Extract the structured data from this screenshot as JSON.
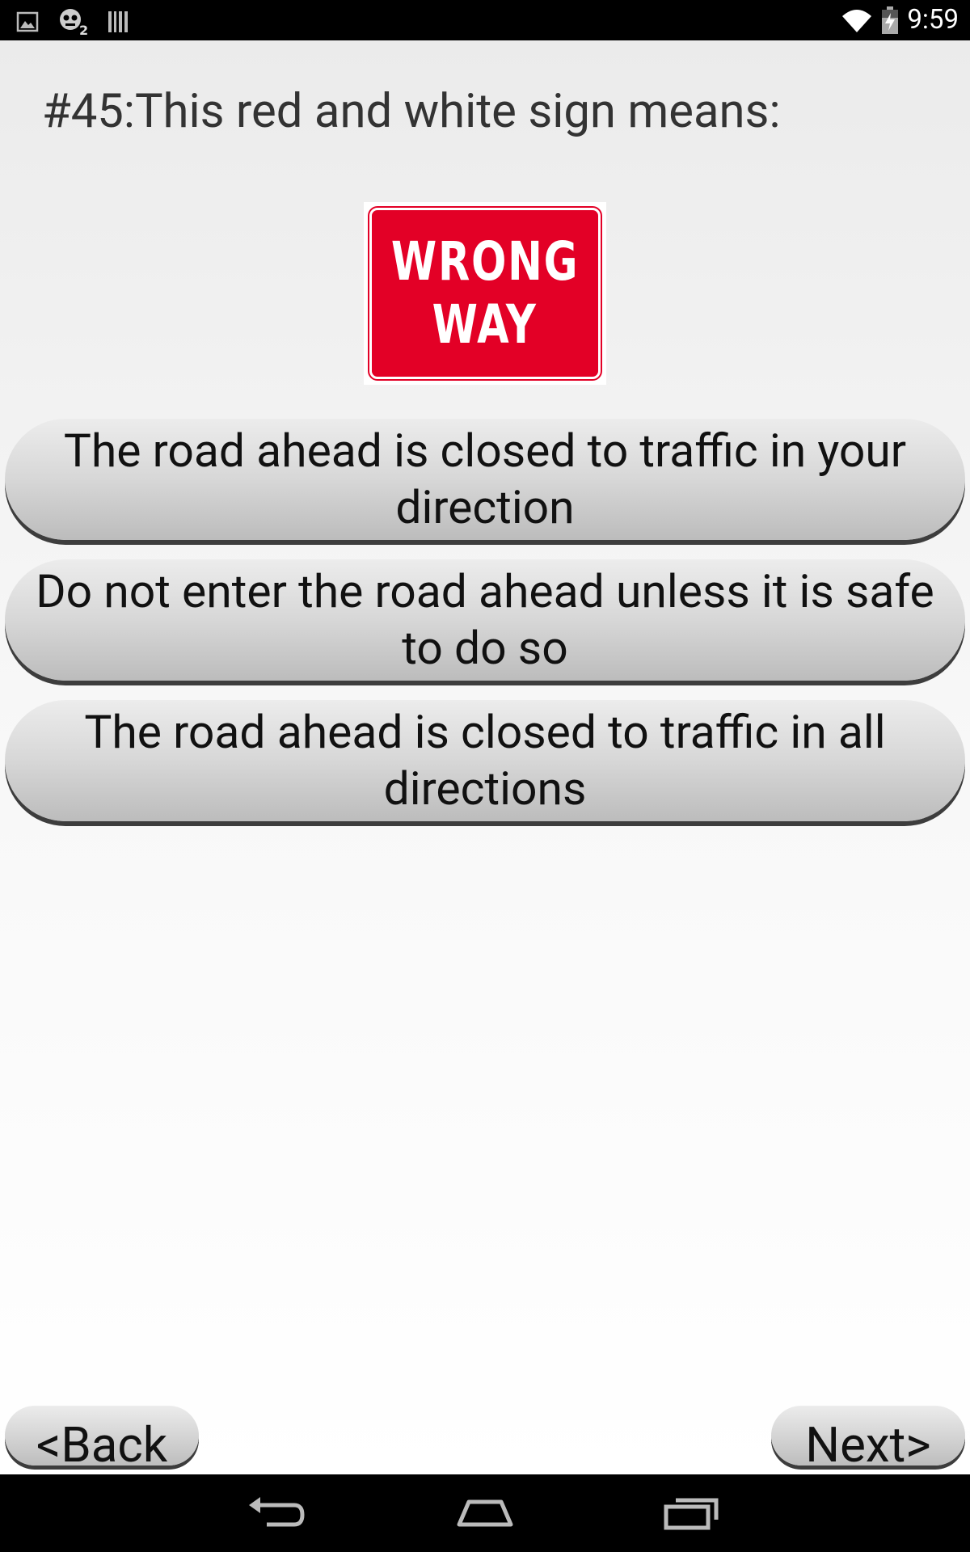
{
  "status_bar": {
    "time": "9:59",
    "left_icons": [
      "image-notification-icon",
      "game-app-icon",
      "barcode-icon"
    ],
    "right_icons": [
      "wifi-icon",
      "battery-charging-icon"
    ]
  },
  "quiz": {
    "question": "#45:This red and white sign means:",
    "sign": {
      "line1": "WRONG",
      "line2": "WAY",
      "colors": {
        "background": "#e30026",
        "text": "#ffffff"
      }
    },
    "answers": [
      {
        "label": "The road ahead is closed to traffic in your direction"
      },
      {
        "label": "Do not enter the road ahead unless it is safe to do so"
      },
      {
        "label": "The road ahead is closed to traffic in all directions"
      }
    ]
  },
  "navigation": {
    "back_label": "<Back",
    "next_label": "Next>"
  },
  "system_nav": {
    "buttons": [
      "back-arrow-icon",
      "home-icon",
      "recent-apps-icon"
    ]
  }
}
